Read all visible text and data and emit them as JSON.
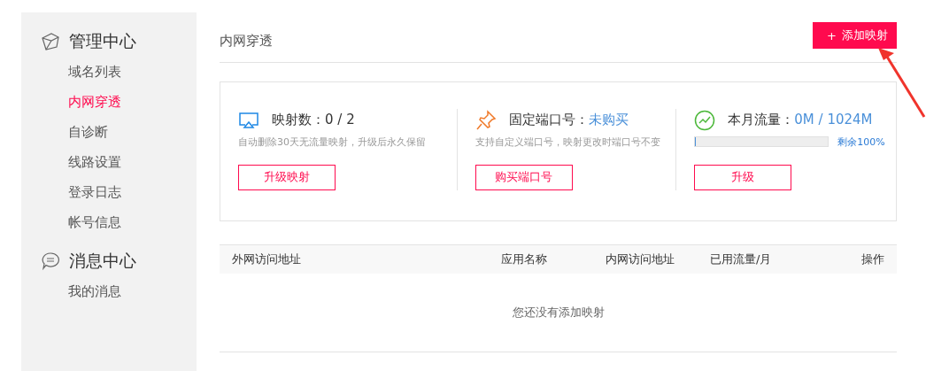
{
  "sidebar": {
    "groups": [
      {
        "kind": "cube",
        "title": "管理中心",
        "items": [
          {
            "label": "域名列表",
            "selected": false
          },
          {
            "label": "内网穿透",
            "selected": true
          },
          {
            "label": "自诊断",
            "selected": false
          },
          {
            "label": "线路设置",
            "selected": false
          },
          {
            "label": "登录日志",
            "selected": false
          },
          {
            "label": "帐号信息",
            "selected": false
          }
        ]
      },
      {
        "kind": "chat",
        "title": "消息中心",
        "items": [
          {
            "label": "我的消息",
            "selected": false
          }
        ]
      }
    ]
  },
  "page_title": "内网穿透",
  "add_button": {
    "icon": "+",
    "label": "添加映射"
  },
  "stats": [
    {
      "kind": "mapping",
      "label": "映射数：",
      "value": "0 / 2",
      "emphasis": false,
      "note": "自动删除30天无流量映射，升级后永久保留",
      "button": "升级映射"
    },
    {
      "kind": "port",
      "label": "固定端口号：",
      "value": "未购买",
      "emphasis": true,
      "note": "支持自定义端口号，映射更改时端口号不变",
      "button": "购买端口号"
    },
    {
      "kind": "traffic",
      "label": "本月流量：",
      "value": "0M / 1024M",
      "emphasis": true,
      "level": 0,
      "remaining": "剩余100%",
      "button": "升级"
    }
  ],
  "table": {
    "columns": [
      "外网访问地址",
      "应用名称",
      "内网访问地址",
      "已用流量/月",
      "操作"
    ],
    "empty_text": "您还没有添加映射"
  }
}
